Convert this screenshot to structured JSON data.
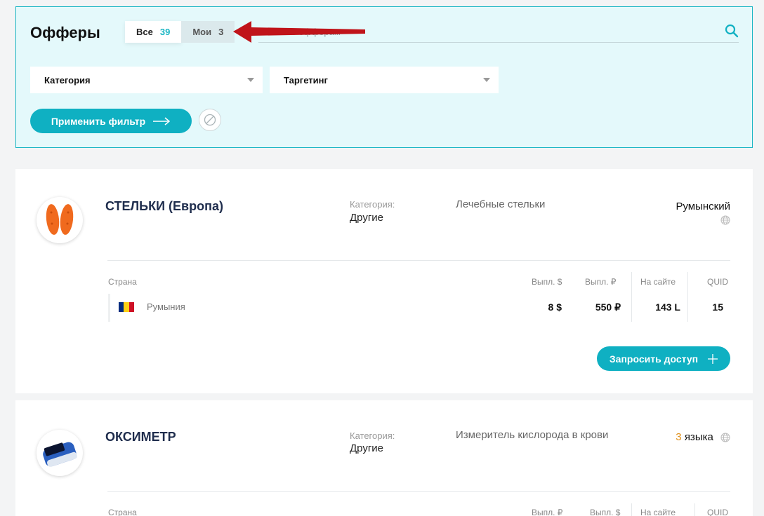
{
  "header": {
    "title": "Офферы",
    "tabs": [
      {
        "label": "Все",
        "count": "39"
      },
      {
        "label": "Мои",
        "count": "3"
      }
    ],
    "search_placeholder": "Поиск по офферам"
  },
  "filters": {
    "category_label": "Категория",
    "targeting_label": "Таргетинг",
    "apply_label": "Применить фильтр"
  },
  "colors": {
    "accent": "#0fb0c2",
    "panel_bg": "#e4f9fb",
    "annotation_arrow": "#c0141a"
  },
  "offers": [
    {
      "name": "СТЕЛЬКИ (Европа)",
      "category_label": "Категория:",
      "category": "Другие",
      "description": "Лечебные стельки",
      "language": "Румынский",
      "table": {
        "headers": {
          "country": "Страна",
          "payout1": "Выпл. $",
          "payout2": "Выпл. ₽",
          "on_site": "На сайте",
          "quid": "QUID"
        },
        "rows": [
          {
            "country": "Румыния",
            "payout1": "8 $",
            "payout2": "550 ₽",
            "on_site": "143 L",
            "quid": "15"
          }
        ]
      },
      "request_label": "Запросить доступ"
    },
    {
      "name": "ОКСИМЕТР",
      "category_label": "Категория:",
      "category": "Другие",
      "description": "Измеритель кислорода в крови",
      "language_count": "3",
      "language_suffix": "языка",
      "table": {
        "headers": {
          "country": "Страна",
          "payout1": "Выпл. ₽",
          "payout2": "Выпл. $",
          "on_site": "На сайте",
          "quid": "QUID"
        }
      }
    }
  ]
}
